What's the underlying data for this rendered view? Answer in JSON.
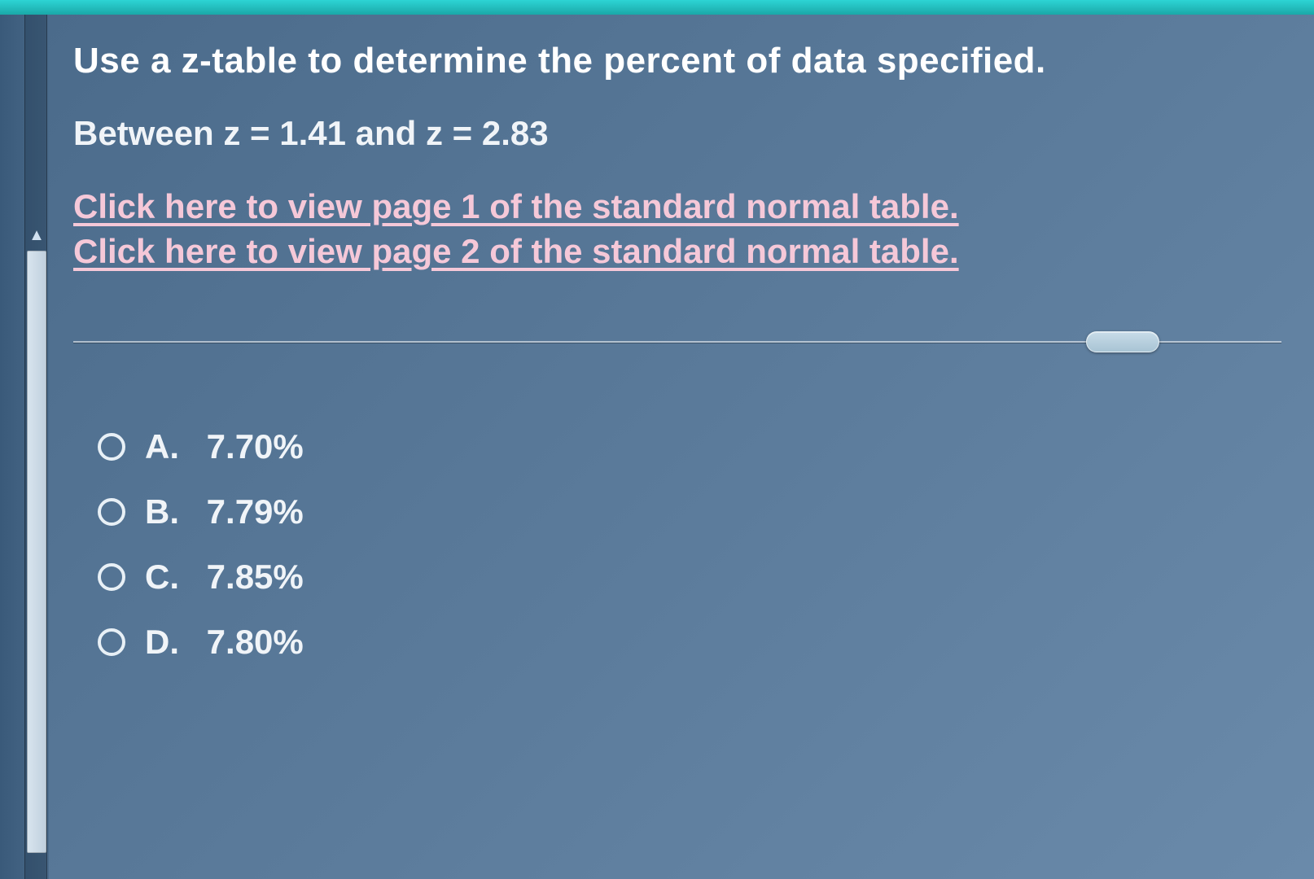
{
  "question": {
    "title": "Use a z-table to determine the percent of data specified.",
    "subtitle": "Between z = 1.41 and z = 2.83"
  },
  "links": {
    "page1": "Click here to view page 1 of the standard normal table.",
    "page2": "Click here to view page 2 of the standard normal table."
  },
  "options": [
    {
      "letter": "A.",
      "value": "7.70%"
    },
    {
      "letter": "B.",
      "value": "7.79%"
    },
    {
      "letter": "C.",
      "value": "7.85%"
    },
    {
      "letter": "D.",
      "value": "7.80%"
    }
  ]
}
